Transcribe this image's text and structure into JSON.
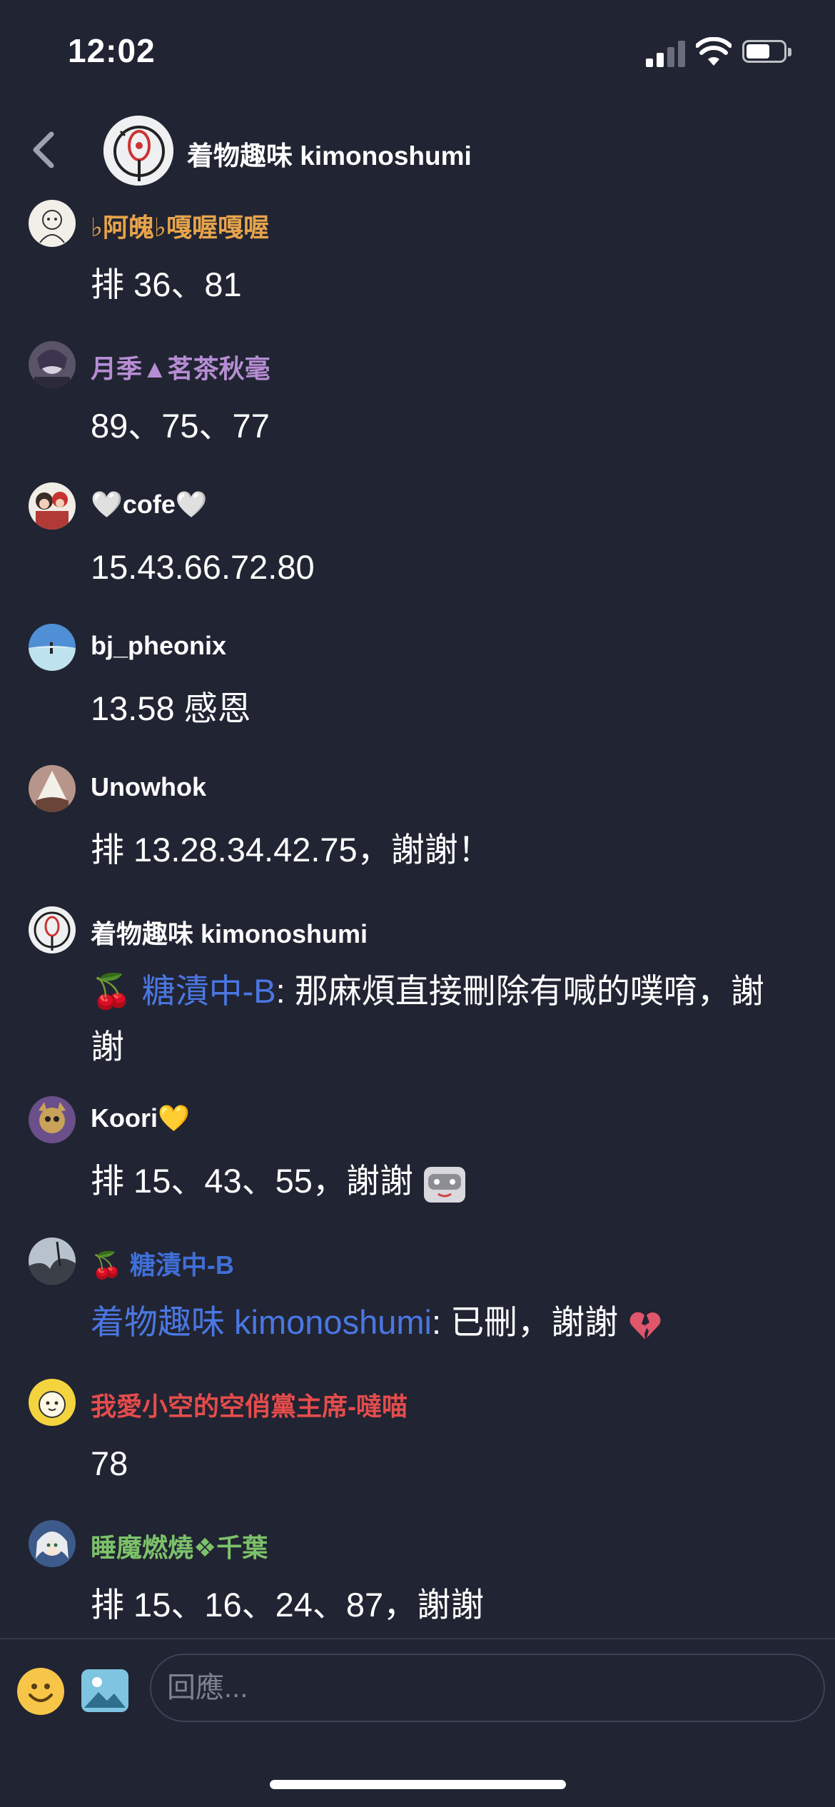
{
  "status": {
    "time": "12:02"
  },
  "header": {
    "title": "着物趣味 kimonoshumi"
  },
  "colors": {
    "background": "#212432",
    "mention": "#4a77e3",
    "name_orange": "#e7a44b",
    "name_purple": "#b68dd4",
    "name_blue": "#3f6fd8",
    "name_red": "#e54c4c",
    "name_green": "#7cc26a"
  },
  "messages": [
    {
      "name": "♭阿魄♭嘎喔嘎喔",
      "text": "排 36、81"
    },
    {
      "name": "月季▲茗茶秋毫",
      "text": "89、75、77"
    },
    {
      "name": "🤍cofe🤍",
      "text": "15.43.66.72.80"
    },
    {
      "name": "bj_pheonix",
      "text": "13.58 感恩"
    },
    {
      "name": "Unowhok",
      "text": "排 13.28.34.42.75，謝謝！"
    },
    {
      "name": "着物趣味 kimonoshumi",
      "mention": "🍒 糖漬中-B",
      "text": ": 那麻煩直接刪除有喊的噗唷，謝謝"
    },
    {
      "name": "Koori💛",
      "text": "排 15、43、55，謝謝 "
    },
    {
      "name": "🍒 糖漬中-B",
      "mention": "着物趣味 kimonoshumi",
      "text": ": 已刪，謝謝 "
    },
    {
      "name": "我愛小空的空俏黨主席-噠喵",
      "text": "78"
    },
    {
      "name": "睡魔燃燒❖千葉",
      "text": "排 15、16、24、87，謝謝"
    }
  ],
  "icons": [
    "back-chevron-icon",
    "emoji-icon",
    "image-icon",
    "broken-heart-icon",
    "sticker-icon"
  ],
  "composer": {
    "placeholder": "回應..."
  }
}
